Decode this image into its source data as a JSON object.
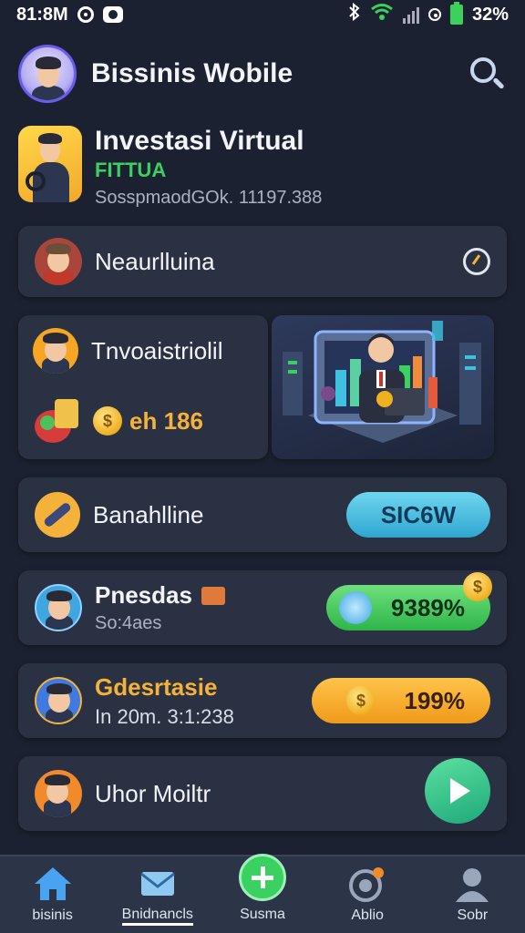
{
  "status_bar": {
    "time": "81:8M",
    "battery": "32%"
  },
  "header": {
    "title": "Bissinis Wobile"
  },
  "promo": {
    "title": "Investasi Virtual",
    "subtitle": "FITTUA",
    "meta": "SosspmaodGOk. 11197.388"
  },
  "cards": {
    "neau": {
      "label": "Neaurlluina"
    },
    "invest": {
      "label": "Tnvoaistriolil",
      "amount": "eh 186"
    },
    "banah": {
      "label": "Banahlline",
      "button": "SIC6W"
    },
    "pnesdas": {
      "title": "Pnesdas",
      "sub": "So:4aes",
      "pill": "9389%"
    },
    "gdesr": {
      "title": "Gdesrtasie",
      "sub": "In 20m. 3:1:238",
      "pill": "199%"
    },
    "uhor": {
      "label": "Uhor Moiltr"
    }
  },
  "nav": {
    "items": [
      {
        "label": "bisinis"
      },
      {
        "label": "Bnidnancls"
      },
      {
        "label": "Susma"
      },
      {
        "label": "Ablio"
      },
      {
        "label": "Sobr"
      }
    ]
  },
  "colors": {
    "background": "#1b2130",
    "card": "#2a3142",
    "green": "#3ad160",
    "gold": "#f5b23a",
    "cyan": "#3fc1e0",
    "nav": "#2c3448"
  }
}
